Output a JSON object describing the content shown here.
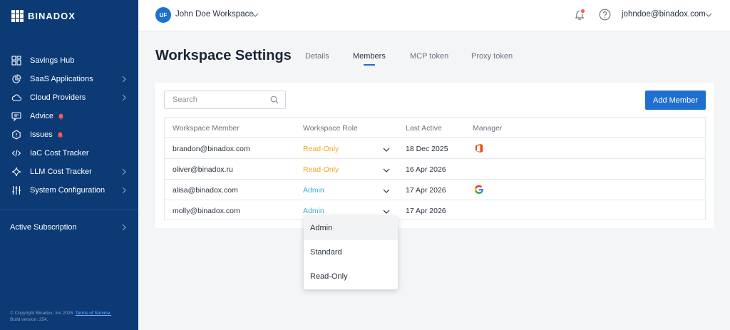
{
  "sidebar": {
    "brand": "BINADOX",
    "items": [
      {
        "label": "Savings Hub",
        "icon": "grid-icon",
        "chevron": false,
        "alert": false
      },
      {
        "label": "SaaS Applications",
        "icon": "pie-chart-icon",
        "chevron": true,
        "alert": false
      },
      {
        "label": "Cloud Providers",
        "icon": "cloud-icon",
        "chevron": true,
        "alert": false
      },
      {
        "label": "Advice",
        "icon": "chat-icon",
        "chevron": false,
        "alert": true
      },
      {
        "label": "Issues",
        "icon": "hexagon-alert-icon",
        "chevron": false,
        "alert": true
      },
      {
        "label": "IaC Cost Tracker",
        "icon": "code-icon",
        "chevron": false,
        "alert": false
      },
      {
        "label": "LLM Cost Tracker",
        "icon": "sparkle-icon",
        "chevron": true,
        "alert": false
      },
      {
        "label": "System Configuration",
        "icon": "sliders-icon",
        "chevron": true,
        "alert": false
      }
    ],
    "active_subscription": "Active Subscription",
    "footer": {
      "copyright": "© Copyright Binadox, Inc 2026.",
      "terms": "Terms of Service.",
      "build": "Build version: 254."
    },
    "alert_color": "#ff5a5a"
  },
  "topbar": {
    "workspace_initials": "UF",
    "workspace_name": "John Doe Workspace",
    "user_email": "johndoe@binadox.com"
  },
  "page": {
    "title": "Workspace Settings",
    "tabs": [
      "Details",
      "Members",
      "MCP token",
      "Proxy token"
    ],
    "active_tab": "Members"
  },
  "members": {
    "search_placeholder": "Search",
    "add_button": "Add Member",
    "columns": [
      "Workspace Member",
      "Workspace Role",
      "Last Active",
      "Manager"
    ],
    "rows": [
      {
        "email": "brandon@binadox.com",
        "role": "Read-Only",
        "last_active": "18 Dec 2025",
        "manager": "office-icon"
      },
      {
        "email": "oliver@binadox.ru",
        "role": "Read-Only",
        "last_active": "16 Apr 2026",
        "manager": ""
      },
      {
        "email": "alisa@binadox.com",
        "role": "Admin",
        "last_active": "17 Apr 2026",
        "manager": "google-icon"
      },
      {
        "email": "molly@binadox.com",
        "role": "Admin",
        "last_active": "17 Apr 2026",
        "manager": ""
      }
    ]
  },
  "role_dropdown": {
    "options": [
      "Admin",
      "Standard",
      "Read-Only"
    ],
    "selected": "Admin"
  },
  "colors": {
    "sidebar_bg": "#0b3a75",
    "accent": "#1f6fd1",
    "read_only": "#f5a623",
    "admin": "#3bb3c9"
  }
}
